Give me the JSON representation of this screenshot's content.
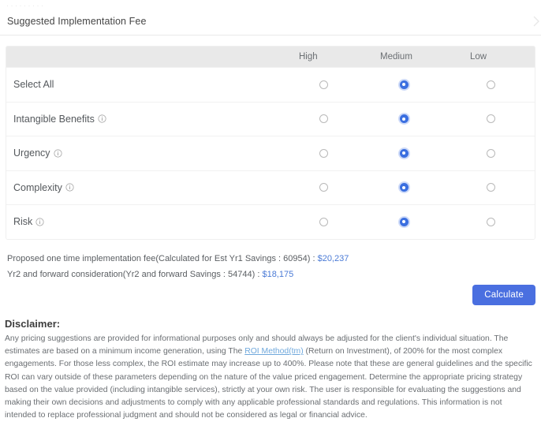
{
  "top_sliver": {
    "ghost_text": "· · · · · · · · ·"
  },
  "header": {
    "title": "Suggested Implementation Fee",
    "chevron_icon": "chevron-right-icon"
  },
  "table": {
    "columns": [
      "High",
      "Medium",
      "Low"
    ],
    "rows": [
      {
        "label": "Select All",
        "has_info": false,
        "selected": "Medium"
      },
      {
        "label": "Intangible Benefits",
        "has_info": true,
        "selected": "Medium"
      },
      {
        "label": "Urgency",
        "has_info": true,
        "selected": "Medium"
      },
      {
        "label": "Complexity",
        "has_info": true,
        "selected": "Medium"
      },
      {
        "label": "Risk",
        "has_info": true,
        "selected": "Medium"
      }
    ]
  },
  "fees": {
    "line1_text": "Proposed one time implementation fee(Calculated for Est Yr1 Savings : 60954) : ",
    "line1_amount": "$20,237",
    "line2_text": "Yr2 and forward consideration(Yr2 and forward Savings : 54744) : ",
    "line2_amount": "$18,175",
    "yr1_savings": "60954",
    "yr2_savings": "54744"
  },
  "actions": {
    "calculate_label": "Calculate"
  },
  "disclaimer": {
    "title": "Disclaimer:",
    "part1": "Any pricing suggestions are provided for informational purposes only and should always be adjusted for the client's individual situation. The estimates are based on a minimum income generation, using The ",
    "link": "ROI Method(tm)",
    "part2": " (Return on Investment), of 200% for the most complex engagements. For those less complex, the ROI estimate may increase up to 400%. Please note that these are general guidelines and the specific ROI can vary outside of these parameters depending on the nature of the value priced engagement. Determine the appropriate pricing strategy based on the value provided (including intangible services), strictly at your own risk. The user is responsible for evaluating the suggestions and making their own decisions and adjustments to comply with any applicable professional standards and regulations. This information is not intended to replace professional judgment and should not be considered as legal or financial advice."
  },
  "colors": {
    "accent_blue": "#4a6fe0",
    "radio_selected": "#3b6fe0",
    "amount_blue": "#4b7bd6",
    "link_blue": "#6fa8dc",
    "header_row_bg": "#e9e9e9"
  }
}
